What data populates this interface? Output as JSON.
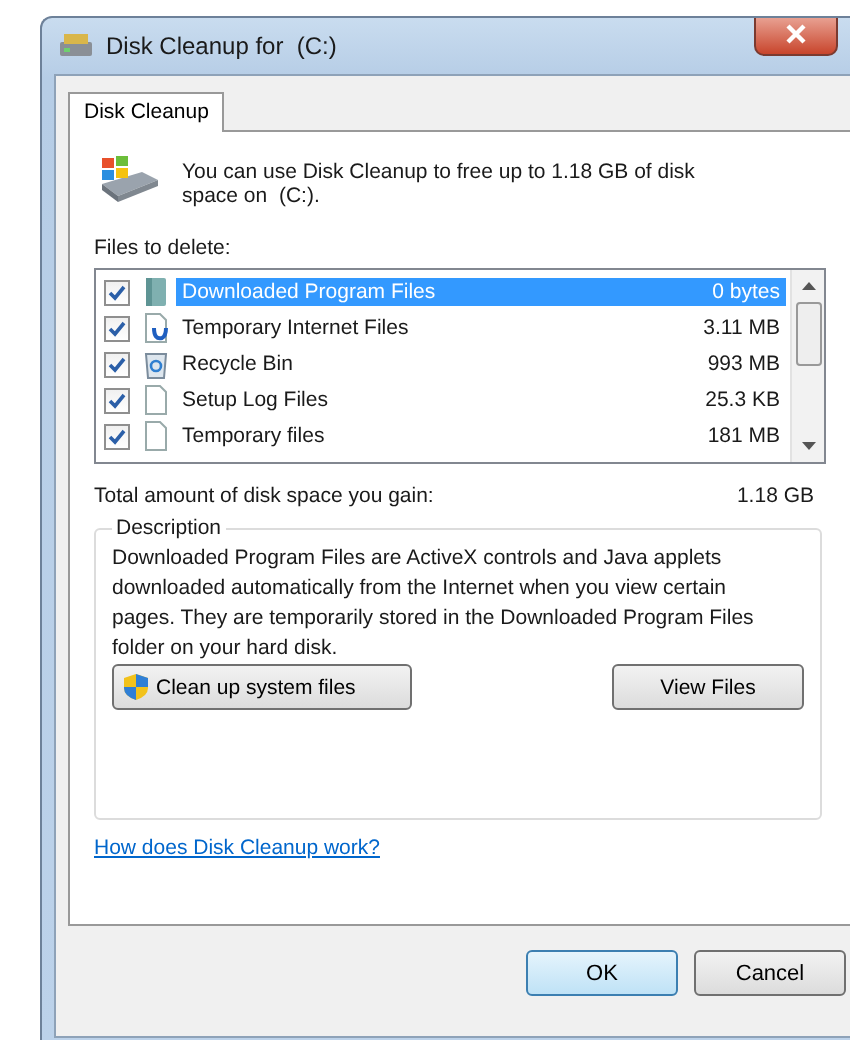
{
  "window": {
    "title": "Disk Cleanup for  (C:)"
  },
  "tabs": [
    {
      "label": "Disk Cleanup",
      "selected": true
    }
  ],
  "intro": "You can use Disk Cleanup to free up to 1.18 GB of disk space on  (C:).",
  "files_label": "Files to delete:",
  "files": [
    {
      "name": "Downloaded Program Files",
      "size": "0 bytes",
      "checked": true,
      "selected": true,
      "kind": "folder"
    },
    {
      "name": "Temporary Internet Files",
      "size": "3.11 MB",
      "checked": true,
      "selected": false,
      "kind": "web"
    },
    {
      "name": "Recycle Bin",
      "size": "993 MB",
      "checked": true,
      "selected": false,
      "kind": "bin"
    },
    {
      "name": "Setup Log Files",
      "size": "25.3 KB",
      "checked": true,
      "selected": false,
      "kind": "file"
    },
    {
      "name": "Temporary files",
      "size": "181 MB",
      "checked": true,
      "selected": false,
      "kind": "file"
    }
  ],
  "total": {
    "label": "Total amount of disk space you gain:",
    "value": "1.18 GB"
  },
  "description": {
    "legend": "Description",
    "text": "Downloaded Program Files are ActiveX controls and Java applets downloaded automatically from the Internet when you view certain pages. They are temporarily stored in the Downloaded Program Files folder on your hard disk."
  },
  "actions": [
    {
      "label": "Clean up system files",
      "kind": "shield"
    },
    {
      "label": "View Files",
      "kind": "plain"
    }
  ],
  "help_link": "How does Disk Cleanup work?",
  "buttons": [
    {
      "label": "OK",
      "kind": "default"
    },
    {
      "label": "Cancel",
      "kind": "normal"
    }
  ]
}
